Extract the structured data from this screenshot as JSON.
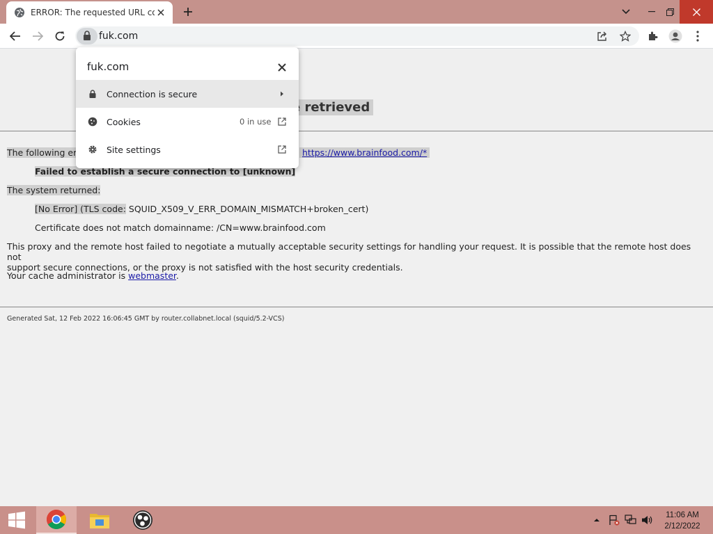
{
  "browser": {
    "tab_title": "ERROR: The requested URL could not be retrieved",
    "url": "fuk.com"
  },
  "popup": {
    "host": "fuk.com",
    "rows": [
      {
        "label": "Connection is secure",
        "icon": "lock-icon",
        "right": "chevron-right-icon"
      },
      {
        "label": "Cookies",
        "meta": "0 in use",
        "icon": "cookie-icon",
        "right": "open-external-icon"
      },
      {
        "label": "Site settings",
        "icon": "gear-icon",
        "right": "open-external-icon"
      }
    ]
  },
  "page": {
    "title_visible": "e retrieved",
    "following_prefix": "The following er",
    "request_url": "https://www.brainfood.com/*",
    "error_message": "Failed to establish a secure connection to [unknown]",
    "system_returned": "The system returned:",
    "no_error_hl": "[No Error] (TLS code:",
    "tls_code": " SQUID_X509_V_ERR_DOMAIN_MISMATCH+broken_cert)",
    "cert_line": "Certificate does not match domainname: /CN=www.brainfood.com",
    "description_1": "This proxy and the remote host failed to negotiate a mutually acceptable security settings for handling your request. It is possible that the remote host does not",
    "description_2": "support secure connections, or the proxy is not satisfied with the host security credentials.",
    "admin_prefix": "Your cache administrator is ",
    "admin_link": "webmaster",
    "admin_suffix": ".",
    "footer": "Generated Sat, 12 Feb 2022 16:06:45 GMT by router.collabnet.local (squid/5.2-VCS)"
  },
  "taskbar": {
    "apps": [
      "chrome-icon",
      "file-explorer-icon",
      "obs-icon"
    ],
    "time": "11:06 AM",
    "date": "2/12/2022"
  },
  "colors": {
    "titlebar": "#c5928c",
    "taskbar": "#c9908a",
    "highlight": "#cfcfcf",
    "link": "#1a1aa6"
  }
}
